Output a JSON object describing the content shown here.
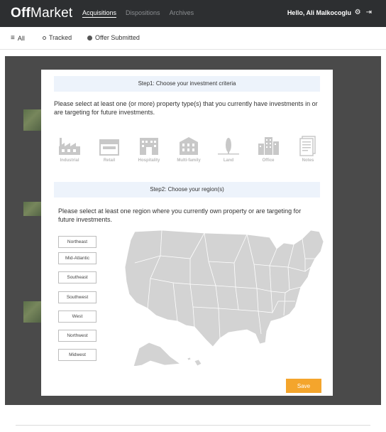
{
  "nav": {
    "logo_bold": "Off",
    "logo_rest": "Market",
    "links": [
      "Acquisitions",
      "Dispositions",
      "Archives"
    ],
    "greeting": "Hello, Ali Malkocoglu",
    "settings_icon": "⚙",
    "logout_icon": "⇥"
  },
  "filters": {
    "all": "All",
    "tracked": "Tracked",
    "offer_submitted": "Offer Submitted"
  },
  "modal": {
    "step1_title": "Step1: Choose your investment criteria",
    "step1_prompt": "Please select at least one (or more) property type(s) that you currently have investments in or are targeting for future investments.",
    "property_types": [
      "Industrial",
      "Retail",
      "Hospitality",
      "Multi-family",
      "Land",
      "Office",
      "Notes"
    ],
    "step2_title": "Step2: Choose your region(s)",
    "step2_prompt": "Please select at least one region where you currently own property or are targeting for future investments.",
    "regions": [
      "Northeast",
      "Mid-Atlantic",
      "Southeast",
      "Southwest",
      "West",
      "Northwest",
      "Midwest"
    ],
    "save_label": "Save"
  },
  "colors": {
    "nav_bg": "#2d2f31",
    "accent": "#f4a52c",
    "step_header_bg": "#edf3fb",
    "map_fill": "#d3d3d3"
  }
}
